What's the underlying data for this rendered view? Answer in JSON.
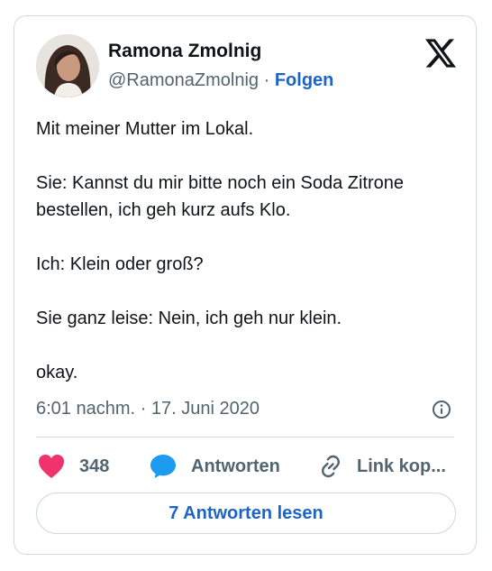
{
  "author": {
    "name": "Ramona Zmolnig",
    "handle": "@RamonaZmolnig",
    "separator": "·",
    "follow_label": "Folgen"
  },
  "platform_icon": "x-logo-icon",
  "tweet": {
    "lines": [
      "Mit meiner Mutter im Lokal.",
      "Sie: Kannst du mir bitte noch ein Soda Zitrone bestellen, ich geh kurz aufs Klo.",
      "Ich: Klein oder groß?",
      "Sie ganz leise: Nein, ich geh nur klein.",
      "okay."
    ],
    "timestamp": "6:01 nachm. · 17. Juni 2020"
  },
  "actions": {
    "like_count": "348",
    "reply_label": "Antworten",
    "copy_link_label": "Link kop..."
  },
  "read_replies_label": "7 Antworten lesen",
  "colors": {
    "like": "#f0336d",
    "reply": "#1d9bf0",
    "link": "#1d64c9",
    "muted": "#536471",
    "border": "#cfd9de"
  }
}
